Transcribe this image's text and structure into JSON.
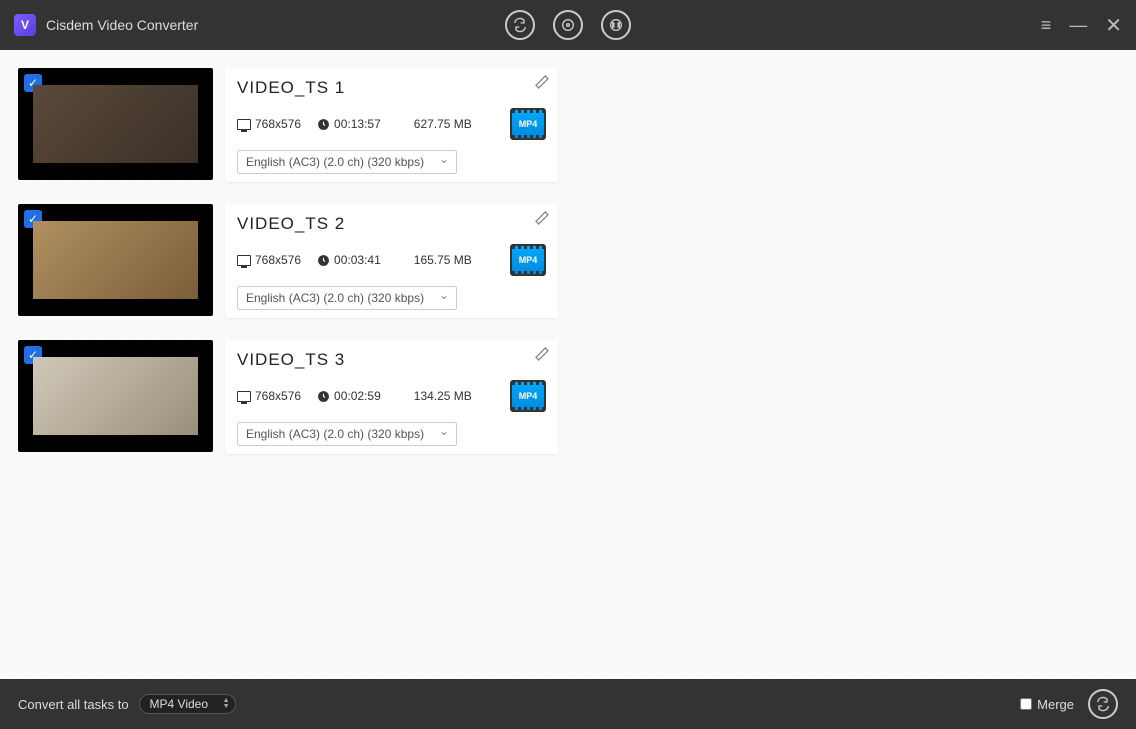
{
  "app": {
    "title": "Cisdem Video Converter"
  },
  "items": [
    {
      "title": "VIDEO_TS 1",
      "resolution": "768x576",
      "duration": "00:13:57",
      "size": "627.75 MB",
      "audio": "English (AC3) (2.0 ch) (320 kbps)",
      "format_label": "MP4",
      "checked": true
    },
    {
      "title": "VIDEO_TS 2",
      "resolution": "768x576",
      "duration": "00:03:41",
      "size": "165.75 MB",
      "audio": "English (AC3) (2.0 ch) (320 kbps)",
      "format_label": "MP4",
      "checked": true
    },
    {
      "title": "VIDEO_TS 3",
      "resolution": "768x576",
      "duration": "00:02:59",
      "size": "134.25 MB",
      "audio": "English (AC3) (2.0 ch) (320 kbps)",
      "format_label": "MP4",
      "checked": true
    }
  ],
  "bottom": {
    "convert_label": "Convert all tasks to",
    "format": "MP4 Video",
    "merge_label": "Merge",
    "merge_checked": false
  }
}
